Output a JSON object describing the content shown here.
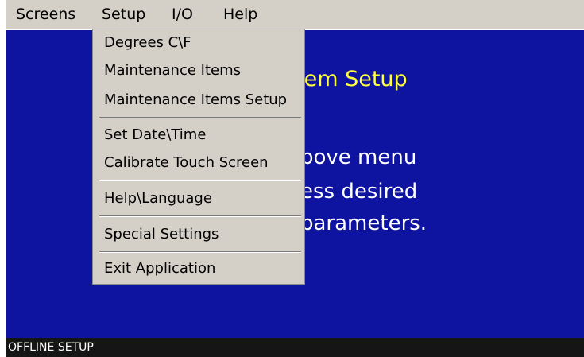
{
  "menubar": {
    "items": [
      "Screens",
      "Setup",
      "I/O",
      "Help"
    ]
  },
  "main": {
    "title_fragment": "tem Setup",
    "instructions": [
      "bove menu",
      "ess desired",
      "parameters."
    ],
    "background_color": "#0f14a0",
    "title_color": "#ffff3c"
  },
  "dropdown": {
    "items": [
      "Degrees C\\F",
      "Maintenance Items",
      "Maintenance Items Setup",
      "Set Date\\Time",
      "Calibrate Touch Screen",
      "Help\\Language",
      "Special Settings",
      "Exit Application"
    ]
  },
  "status": {
    "text": "OFFLINE SETUP"
  }
}
